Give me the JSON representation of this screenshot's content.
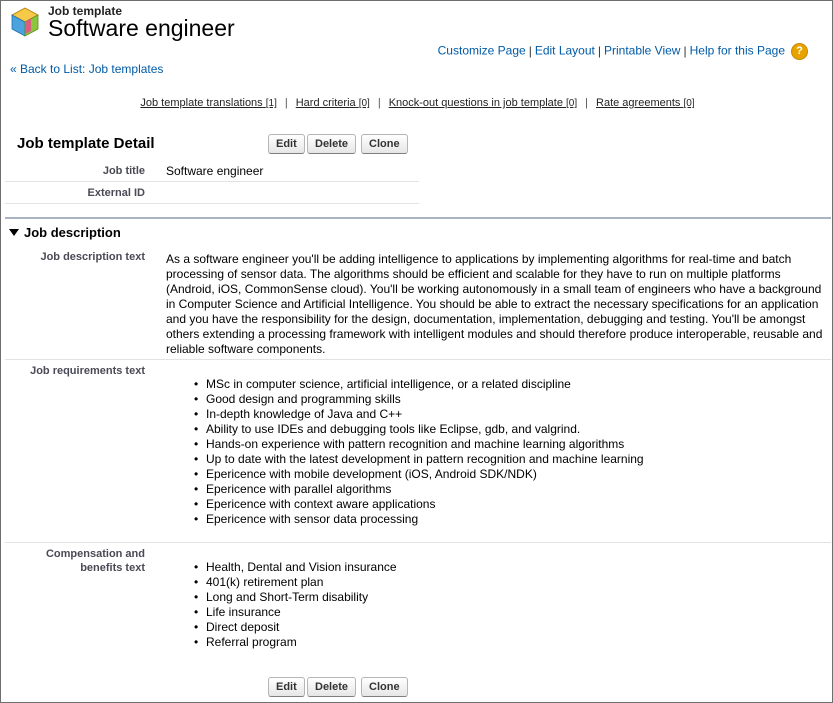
{
  "header": {
    "eyebrow": "Job template",
    "title": "Software engineer"
  },
  "top_links": {
    "customize": "Customize Page",
    "edit_layout": "Edit Layout",
    "printable": "Printable View",
    "help": "Help for this Page",
    "separator": "|"
  },
  "back_link": "« Back to List: Job templates",
  "related_lists": [
    {
      "label": "Job template translations",
      "count": "[1]"
    },
    {
      "label": "Hard criteria",
      "count": "[0]"
    },
    {
      "label": "Knock-out questions in job template",
      "count": "[0]"
    },
    {
      "label": "Rate agreements",
      "count": "[0]"
    }
  ],
  "detail": {
    "heading": "Job template Detail",
    "buttons": {
      "edit": "Edit",
      "delete": "Delete",
      "clone": "Clone"
    },
    "job_title_label": "Job title",
    "job_title_value": "Software engineer",
    "external_id_label": "External ID",
    "external_id_value": ""
  },
  "section": {
    "title": "Job description",
    "desc_label": "Job description text",
    "desc_text": "As a software engineer you'll be adding intelligence to applications by implementing algorithms for real-time and batch processing of sensor data. The algorithms should be efficient and scalable for they have to run on multiple platforms (Android, iOS, CommonSense cloud).   You'll be working autonomously in a small team of engineers who have a background in Computer Science and Artificial Intelligence. You should be able  to extract  the necessary specifications for an application and you have the responsibility for the design, documentation, implementation, debugging and testing. You'll be amongst others extending a processing framework with intelligent modules and should therefore produce interoperable, reusable and reliable software components.",
    "req_label": "Job requirements text",
    "requirements": [
      "MSc in computer science, artificial intelligence, or a related discipline",
      "Good design and programming skills",
      "In-depth knowledge of Java and C++",
      "Ability to use IDEs and debugging tools like Eclipse, gdb, and valgrind.",
      "Hands-on experience with pattern recognition and machine learning algorithms",
      "Up to date with the latest development in pattern recognition and machine learning",
      "Epericence with mobile development (iOS, Android SDK/NDK)",
      "Epericence with parallel algorithms",
      "Epericence with context aware applications",
      "Epericence with sensor data processing"
    ],
    "comp_label_line1": "Compensation and",
    "comp_label_line2": "benefits text",
    "benefits": [
      "Health, Dental and Vision insurance",
      "401(k) retirement plan",
      "Long and Short-Term disability",
      "Life insurance",
      "Direct deposit",
      "Referral program"
    ]
  },
  "colors": {
    "link": "#015ba7",
    "label": "#4a4a56",
    "section_rule": "#a9b4c2",
    "help_icon": "#e8a300"
  }
}
